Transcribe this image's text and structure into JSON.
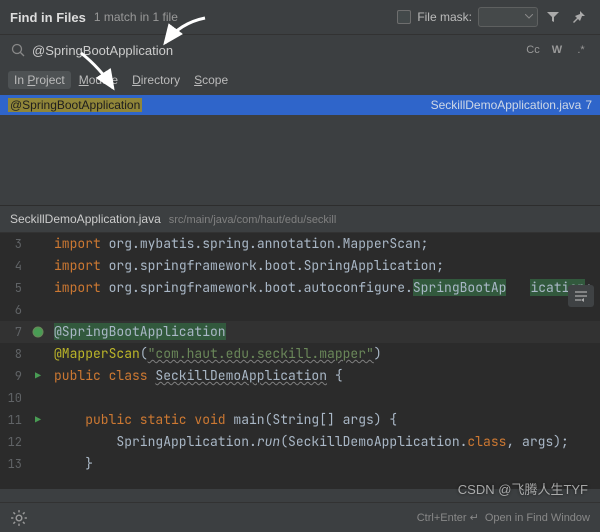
{
  "header": {
    "title": "Find in Files",
    "subtitle": "1 match in 1 file",
    "filemask_label": "File mask:"
  },
  "search": {
    "query": "@SpringBootApplication",
    "opt_case": "Cc",
    "opt_words": "W",
    "opt_regex": ".*"
  },
  "scope": {
    "tabs": [
      {
        "pre": "In ",
        "u": "P",
        "post": "roject"
      },
      {
        "pre": "",
        "u": "M",
        "post": "odule"
      },
      {
        "pre": "",
        "u": "D",
        "post": "irectory"
      },
      {
        "pre": "",
        "u": "S",
        "post": "cope"
      }
    ]
  },
  "result": {
    "match": "@SpringBootApplication",
    "file": "SeckillDemoApplication.java",
    "line": "7"
  },
  "preview": {
    "filename": "SeckillDemoApplication.java",
    "path": "src/main/java/com/haut/edu/seckill"
  },
  "code": {
    "l3": {
      "n": "3",
      "a": "import",
      "b": " org.mybatis.spring.annotation.MapperScan;"
    },
    "l4": {
      "n": "4",
      "a": "import",
      "b": " org.springframework.boot.SpringApplication;"
    },
    "l5": {
      "n": "5",
      "a": "import",
      "b": " org.springframework.boot.autoconfigure.",
      "c": "SpringBootAp",
      "d": "ication",
      "e": ";"
    },
    "l6": {
      "n": "6"
    },
    "l7": {
      "n": "7",
      "a": "@SpringBootApplication"
    },
    "l8": {
      "n": "8",
      "a": "@MapperScan",
      "b": "(",
      "c": "\"com.haut.edu.seckill.mapper\"",
      "d": ")"
    },
    "l9": {
      "n": "9",
      "a": "public class ",
      "b": "SeckillDemoApplication",
      "c": " {"
    },
    "l10": {
      "n": "10"
    },
    "l11": {
      "n": "11",
      "a": "    public static ",
      "b": "void",
      "c": " main(String[] args) {"
    },
    "l12": {
      "n": "12",
      "a": "        SpringApplication.",
      "b": "run",
      "c": "(SeckillDemoApplication.",
      "d": "class",
      "e": ", args);"
    },
    "l13": {
      "n": "13",
      "a": "    }"
    }
  },
  "footer": {
    "hint": "Ctrl+Enter ↵",
    "action": "Open in Find Window"
  },
  "watermark": "CSDN @飞腾人生TYF"
}
